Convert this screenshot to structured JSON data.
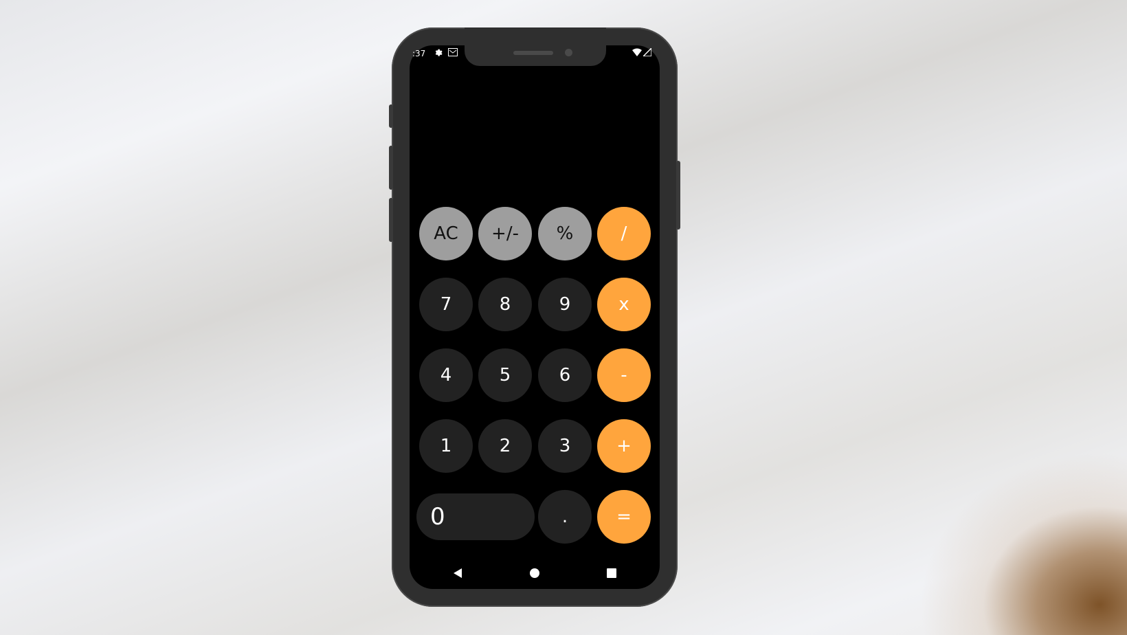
{
  "status_bar": {
    "time": ":37",
    "left_icons": [
      "settings-icon",
      "mail-icon"
    ],
    "right_icons": [
      "wifi-icon",
      "signal-icon"
    ]
  },
  "display": {
    "value": ""
  },
  "keypad": {
    "row1": [
      "AC",
      "+/-",
      "%",
      "/"
    ],
    "row2": [
      "7",
      "8",
      "9",
      "x"
    ],
    "row3": [
      "4",
      "5",
      "6",
      "-"
    ],
    "row4": [
      "1",
      "2",
      "3",
      "+"
    ],
    "row5": [
      "0",
      ".",
      "="
    ]
  },
  "colors": {
    "function_key": "#9e9e9e",
    "digit_key": "#222222",
    "operator_key": "#ffa53d",
    "screen_background": "#000000"
  },
  "navigation": {
    "icons": [
      "back-icon",
      "home-icon",
      "recents-icon"
    ]
  }
}
